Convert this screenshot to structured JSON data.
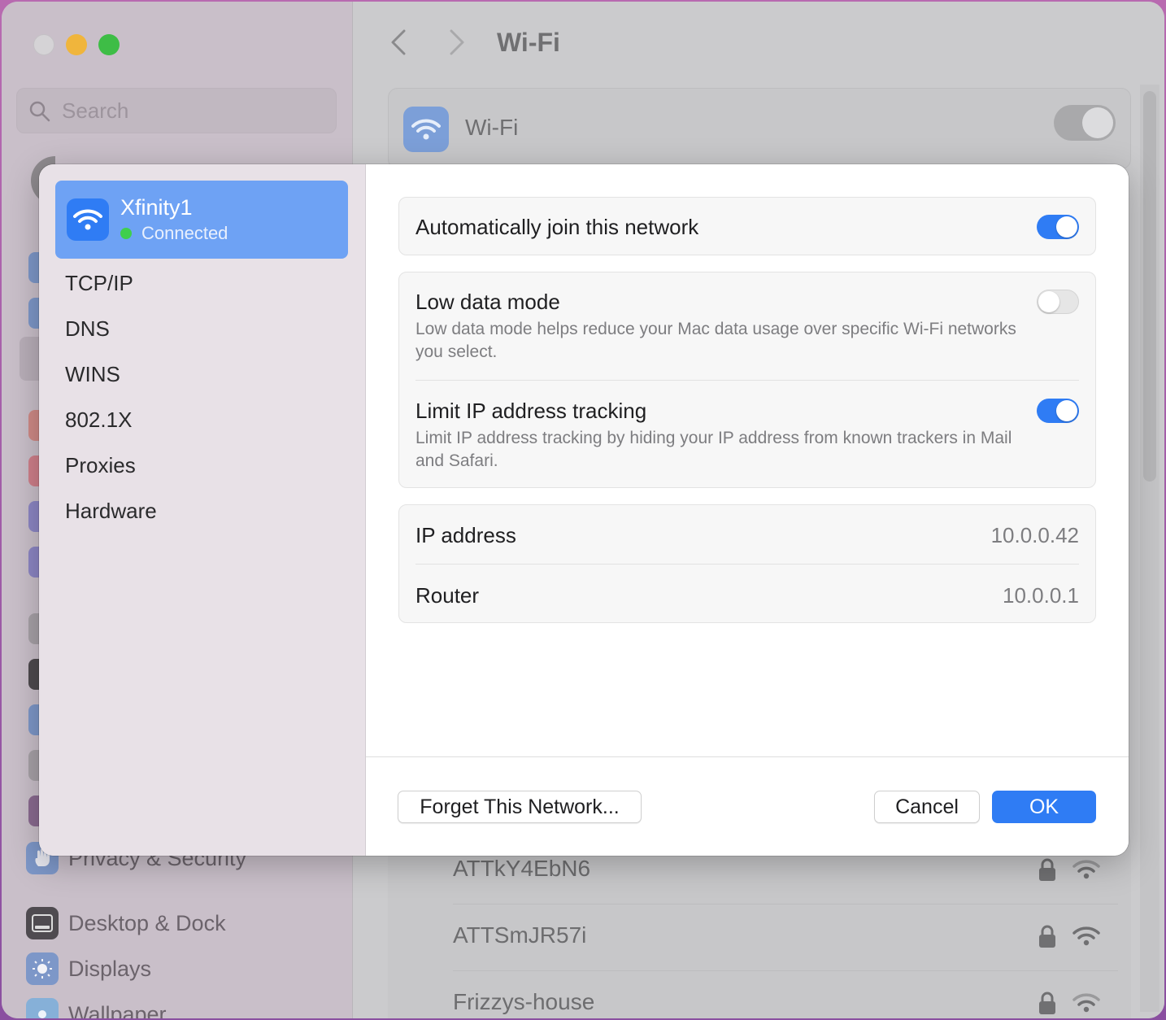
{
  "background": {
    "search": {
      "placeholder": "Search"
    },
    "sidebar": {
      "items": [
        {
          "label": "Privacy & Security",
          "icon": "hand-icon"
        },
        {
          "label": "Desktop & Dock",
          "icon": "dock-icon"
        },
        {
          "label": "Displays",
          "icon": "sun-icon"
        },
        {
          "label": "Wallpaper",
          "icon": "flower-icon"
        }
      ]
    },
    "main": {
      "title": "Wi-Fi",
      "wifi_label": "Wi-Fi",
      "networks": [
        {
          "name": "ATTkY4EbN6"
        },
        {
          "name": "ATTSmJR57i"
        },
        {
          "name": "Frizzys-house"
        }
      ]
    }
  },
  "sheet": {
    "network": {
      "name": "Xfinity1",
      "status": "Connected"
    },
    "sidebar_links": [
      "TCP/IP",
      "DNS",
      "WINS",
      "802.1X",
      "Proxies",
      "Hardware"
    ],
    "auto_join": {
      "label": "Automatically join this network",
      "enabled": true
    },
    "low_data": {
      "label": "Low data mode",
      "description": "Low data mode helps reduce your Mac data usage over specific Wi-Fi networks you select.",
      "enabled": false
    },
    "limit_ip": {
      "label": "Limit IP address tracking",
      "description": "Limit IP address tracking by hiding your IP address from known trackers in Mail and Safari.",
      "enabled": true
    },
    "info": [
      {
        "label": "IP address",
        "value": "10.0.0.42"
      },
      {
        "label": "Router",
        "value": "10.0.0.1"
      }
    ],
    "buttons": {
      "forget": "Forget This Network...",
      "cancel": "Cancel",
      "ok": "OK"
    }
  },
  "colors": {
    "accent": "#2f7cf4",
    "selected_row": "#6ea2f4",
    "connected_dot": "#3fcf4d"
  }
}
